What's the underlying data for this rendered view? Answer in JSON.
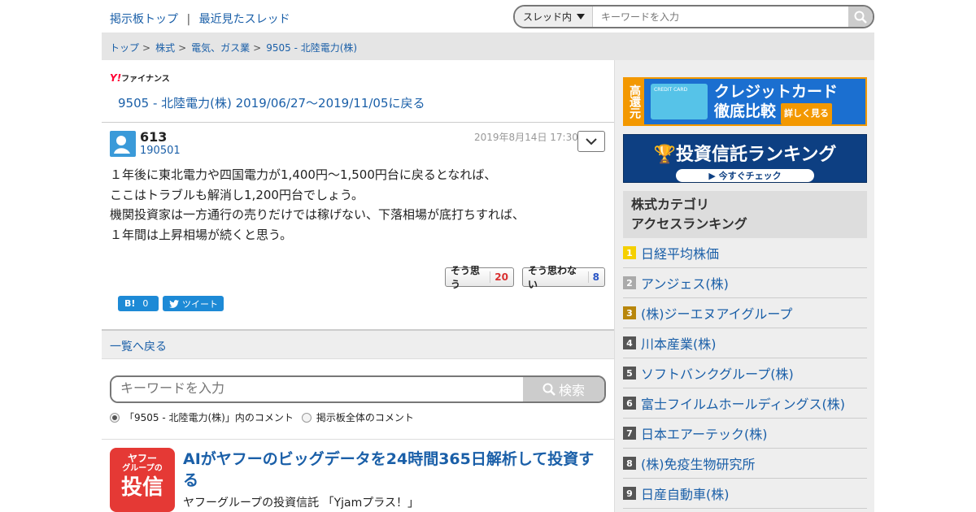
{
  "header": {
    "link_board_top": "掲示板トップ",
    "separator": "|",
    "link_recent": "最近見たスレッド",
    "search_scope": "スレッド内",
    "search_placeholder": "キーワードを入力"
  },
  "breadcrumb": {
    "items": [
      "トップ",
      "株式",
      "電気、ガス業",
      "9505 - 北陸電力(株)"
    ],
    "arrow": ">"
  },
  "thread": {
    "brand": "ファイナンス",
    "brand_y": "Y!",
    "back_link": "9505 - 北陸電力(株) 2019/06/27〜2019/11/05に戻る"
  },
  "post": {
    "number": "613",
    "user": "190501",
    "date": "2019年8月14日 17:30",
    "lines": [
      "１年後に東北電力や四国電力が1,400円～1,500円台に戻るとなれば、",
      "ここはトラブルも解消し1,200円台でしょう。",
      "機関投資家は一方通行の売りだけでは稼げない、下落相場が底打ちすれば、",
      "１年間は上昇相場が続くと思う。"
    ],
    "agree_label": "そう思う",
    "agree_count": "20",
    "disagree_label": "そう思わない",
    "disagree_count": "8",
    "hatena_label": "B!",
    "hatena_count": "0",
    "tweet_label": "ツイート"
  },
  "list_back": "一覧へ戻る",
  "bottom_search": {
    "placeholder": "キーワードを入力",
    "button": "検索",
    "option_thread": "「9505 - 北陸電力(株)」内のコメント",
    "option_all": "掲示板全体のコメント"
  },
  "ad": {
    "logo_line1": "ヤフー",
    "logo_line2": "グループの",
    "logo_line3": "投信",
    "title": "AIがヤフーのビッグデータを24時間365日解析して投資する",
    "subtitle": "ヤフーグループの投資信託 「Yjamプラス！」"
  },
  "sidebar": {
    "banner1_tag": "高還元",
    "banner1_card": "CREDIT CARD",
    "banner1_line1": "クレジットカード",
    "banner1_line2": "徹底比較",
    "banner1_more": "詳しく見る",
    "banner2_title": "投資信託ランキング",
    "banner2_cta": "今すぐチェック",
    "ranking_title_1": "株式カテゴリ",
    "ranking_title_2": "アクセスランキング",
    "ranking": [
      {
        "rank": "1",
        "name": "日経平均株価"
      },
      {
        "rank": "2",
        "name": "アンジェス(株)"
      },
      {
        "rank": "3",
        "name": "(株)ジーエヌアイグループ"
      },
      {
        "rank": "4",
        "name": "川本産業(株)"
      },
      {
        "rank": "5",
        "name": "ソフトバンクグループ(株)"
      },
      {
        "rank": "6",
        "name": "富士フイルムホールディングス(株)"
      },
      {
        "rank": "7",
        "name": "日本エアーテック(株)"
      },
      {
        "rank": "8",
        "name": "(株)免疫生物研究所"
      },
      {
        "rank": "9",
        "name": "日産自動車(株)"
      }
    ]
  }
}
